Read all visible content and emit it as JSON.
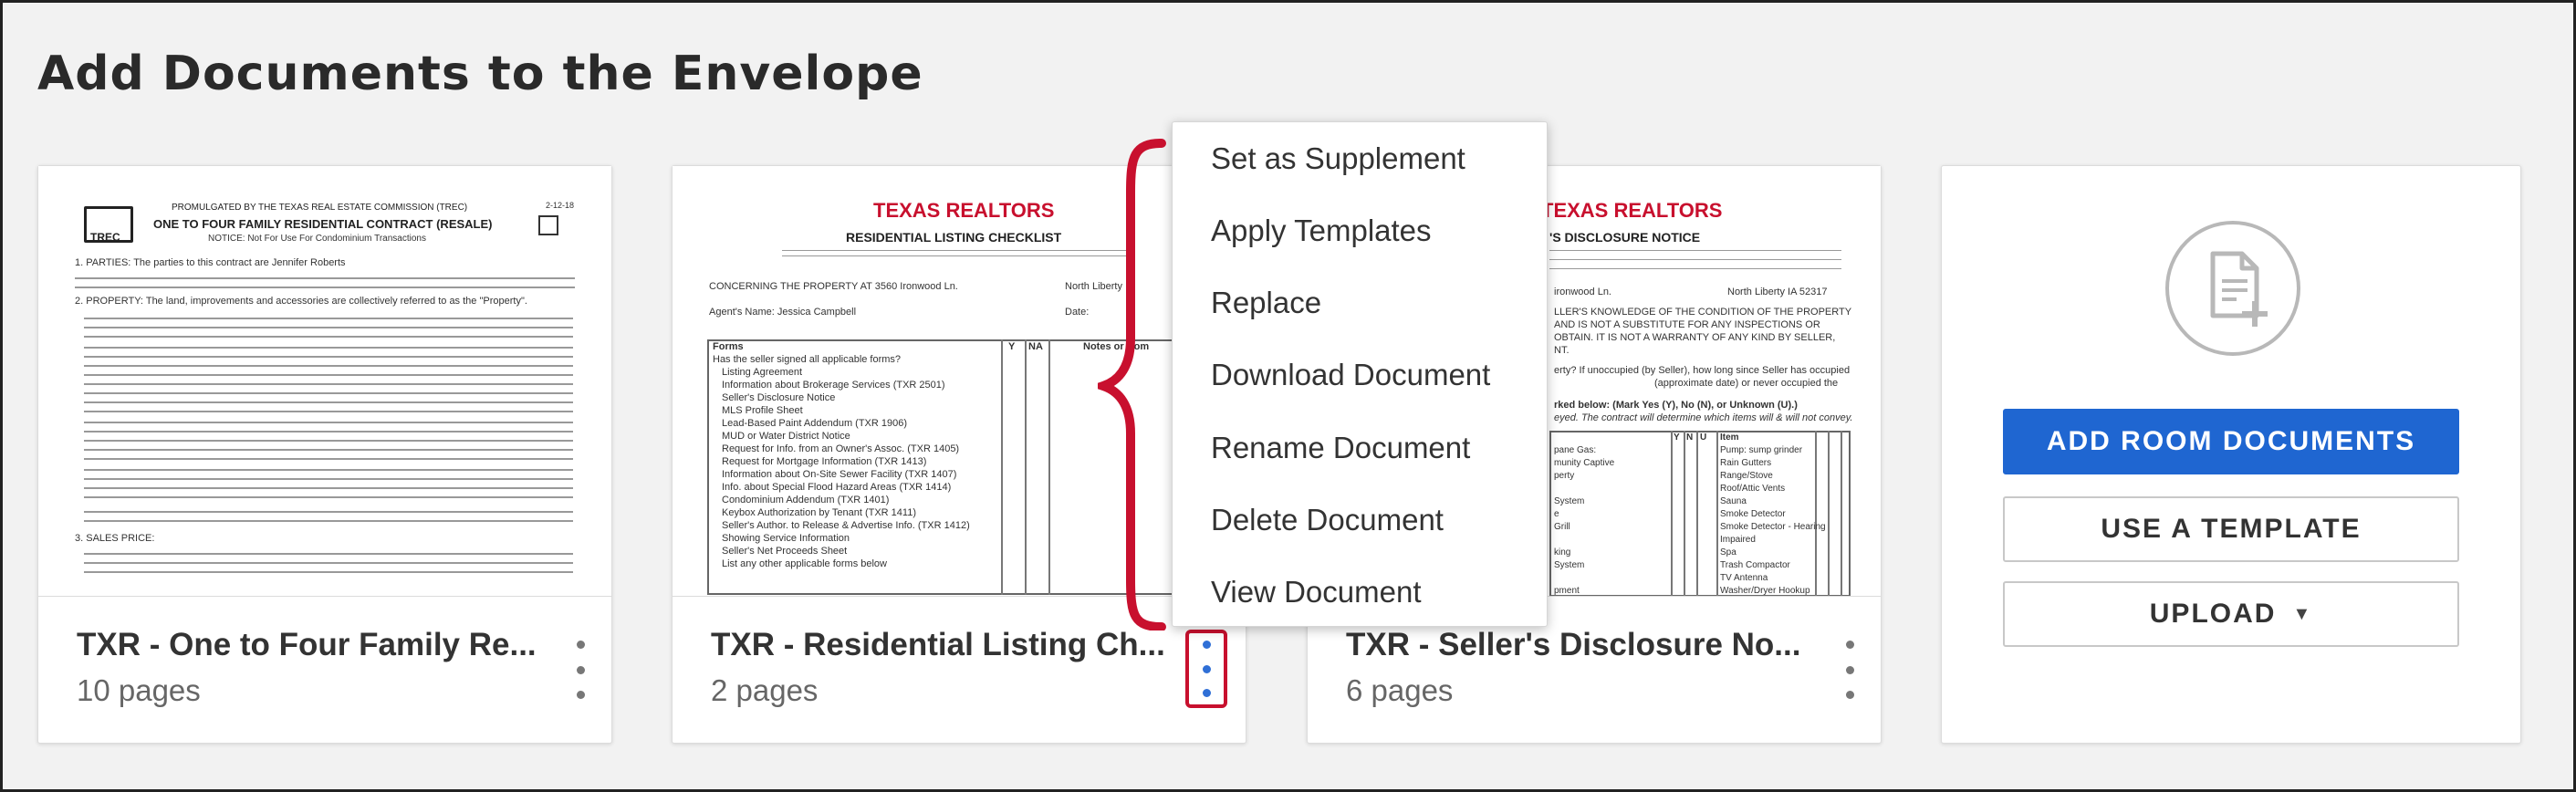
{
  "page": {
    "title": "Add Documents to the Envelope"
  },
  "documents": [
    {
      "name": "TXR - One to Four Family Re...",
      "pages": "10 pages"
    },
    {
      "name": "TXR - Residential Listing Ch...",
      "pages": "2 pages"
    },
    {
      "name": "TXR - Seller's Disclosure No...",
      "pages": "6 pages"
    }
  ],
  "thumbs": {
    "contract": {
      "header1": "PROMULGATED BY THE TEXAS REAL ESTATE COMMISSION (TREC)",
      "header2": "ONE TO FOUR FAMILY RESIDENTIAL CONTRACT (RESALE)",
      "notice": "NOTICE: Not For Use For Condominium Transactions",
      "logo": "TREC",
      "date": "2-12-18",
      "parties": "1. PARTIES: The parties to this contract are Jennifer Roberts",
      "land": "2. PROPERTY: The land, improvements and accessories are collectively referred to as the \"Property\".",
      "sales": "3. SALES PRICE:"
    },
    "checklist": {
      "brand": "TEXAS REALTORS",
      "title": "RESIDENTIAL LISTING CHECKLIST",
      "property": "CONCERNING THE PROPERTY AT 3560 Ironwood Ln.",
      "city": "North Liberty",
      "agent": "Agent's Name: Jessica Campbell",
      "date_label": "Date:",
      "col_forms": "Forms",
      "col_y": "Y",
      "col_na": "NA",
      "col_notes": "Notes or Com",
      "rows": [
        "Has the seller signed all applicable forms?",
        "Listing Agreement",
        "Information about Brokerage Services (TXR 2501)",
        "Seller's Disclosure Notice",
        "MLS Profile Sheet",
        "Lead-Based Paint Addendum (TXR 1906)",
        "MUD or Water District Notice",
        "Request for Info. from an Owner's Assoc. (TXR 1405)",
        "Request for Mortgage Information (TXR 1413)",
        "Information about On-Site Sewer Facility (TXR 1407)",
        "Info. about Special Flood Hazard Areas (TXR 1414)",
        "Condominium Addendum (TXR 1401)",
        "Keybox Authorization by Tenant (TXR 1411)",
        "Seller's Author. to Release & Advertise Info. (TXR 1412)",
        "Showing Service Information",
        "Seller's Net Proceeds Sheet",
        "List any other applicable forms below"
      ]
    },
    "disclosure": {
      "brand": "TEXAS REALTORS",
      "title": "'S DISCLOSURE NOTICE",
      "lines": [
        "ironwood Ln.",
        "North Liberty   IA 52317",
        "LLER'S KNOWLEDGE OF THE CONDITION OF THE PROPERTY",
        "AND IS NOT A SUBSTITUTE FOR ANY INSPECTIONS OR",
        "OBTAIN. IT IS NOT A WARRANTY OF ANY KIND BY SELLER,",
        "NT.",
        "erty? If unoccupied (by Seller), how long since Seller has occupied",
        "(approximate date) or   never occupied the",
        "rked below: (Mark Yes (Y), No (N), or Unknown (U).)",
        "eyed. The contract will determine which items will & will not convey."
      ],
      "left_items": [
        "pane Gas:",
        "munity Captive",
        "perty",
        "",
        "System",
        "e",
        "Grill",
        "",
        "king",
        "System",
        "",
        "pment"
      ],
      "right_items": [
        "Pump:   sump   grinder",
        "Rain Gutters",
        "Range/Stove",
        "Roof/Attic Vents",
        "Sauna",
        "Smoke Detector",
        "Smoke Detector - Hearing",
        "Impaired",
        "Spa",
        "Trash Compactor",
        "TV Antenna",
        "Washer/Dryer Hookup"
      ],
      "item_header": "Item",
      "ynu": [
        "Y",
        "N",
        "U"
      ]
    }
  },
  "menu": {
    "items": [
      "Set as Supplement",
      "Apply Templates",
      "Replace",
      "Download Document",
      "Rename Document",
      "Delete Document",
      "View Document"
    ]
  },
  "actions": {
    "add_room": "ADD ROOM DOCUMENTS",
    "template": "USE A TEMPLATE",
    "upload": "UPLOAD"
  },
  "icons": {
    "add_document": "add-document-icon",
    "more": "more-vertical-icon",
    "caret": "caret-down-icon"
  },
  "colors": {
    "primary": "#1f66d1",
    "highlight": "#c8102e",
    "brand_red": "#c8102e"
  }
}
